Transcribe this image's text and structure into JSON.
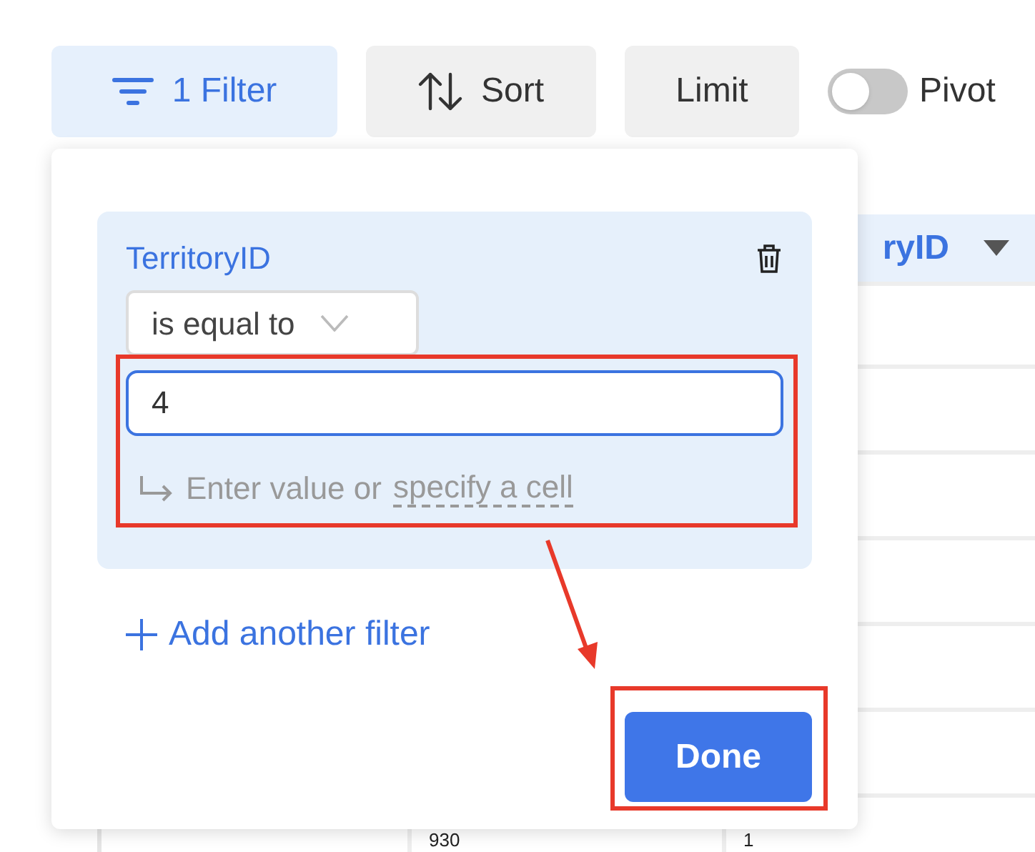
{
  "toolbar": {
    "filter_button": {
      "label": "1 Filter",
      "active": true
    },
    "buttons": [
      {
        "label": "Sort",
        "kind": "sort"
      },
      {
        "label": "Limit",
        "kind": "plain"
      }
    ],
    "pivot": {
      "label": "Pivot",
      "on": false
    }
  },
  "table": {
    "column_3_header": "ryID",
    "last_row": [
      "930",
      "1"
    ]
  },
  "filter_popup": {
    "field": "TerritoryID",
    "operator": "is equal to",
    "value": "4",
    "hint": "Enter value or",
    "hint_link": "specify a cell",
    "add_label": "Add another filter",
    "done_label": "Done"
  }
}
